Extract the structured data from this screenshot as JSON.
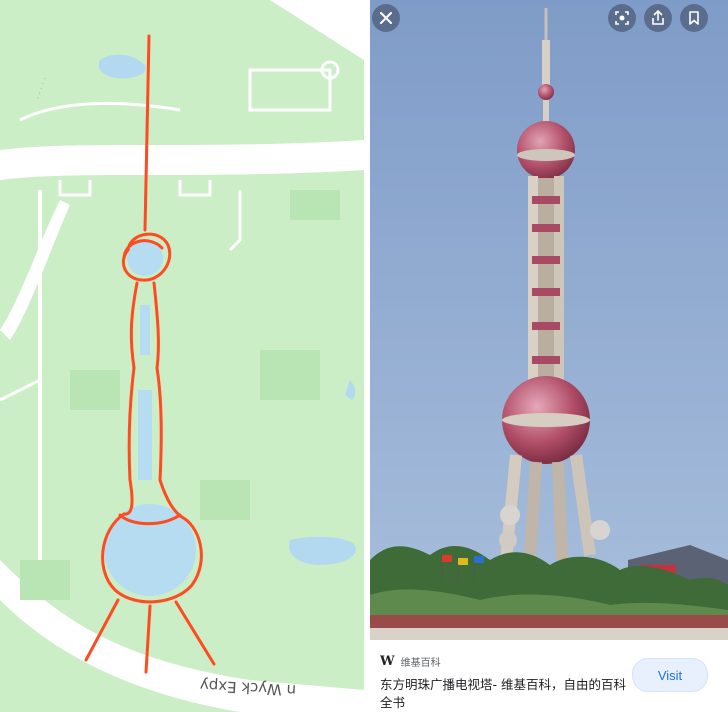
{
  "map": {
    "road_label": "n Wyck Expy"
  },
  "photo_viewer": {
    "close_icon": "close-icon",
    "lens_icon": "lens-search-icon",
    "share_icon": "share-icon",
    "bookmark_icon": "bookmark-icon"
  },
  "result": {
    "source_logo": "W",
    "source_name": "维基百科",
    "title": "东方明珠广播电视塔- 维基百科，自由的百科全书",
    "visit_label": "Visit"
  },
  "colors": {
    "park_green": "#c9edc6",
    "water_blue": "#b6dcf2",
    "drawing_orange": "#ff4b1f",
    "sky_blue": "#8fa9cf",
    "tower_pink": "#b2506a"
  }
}
